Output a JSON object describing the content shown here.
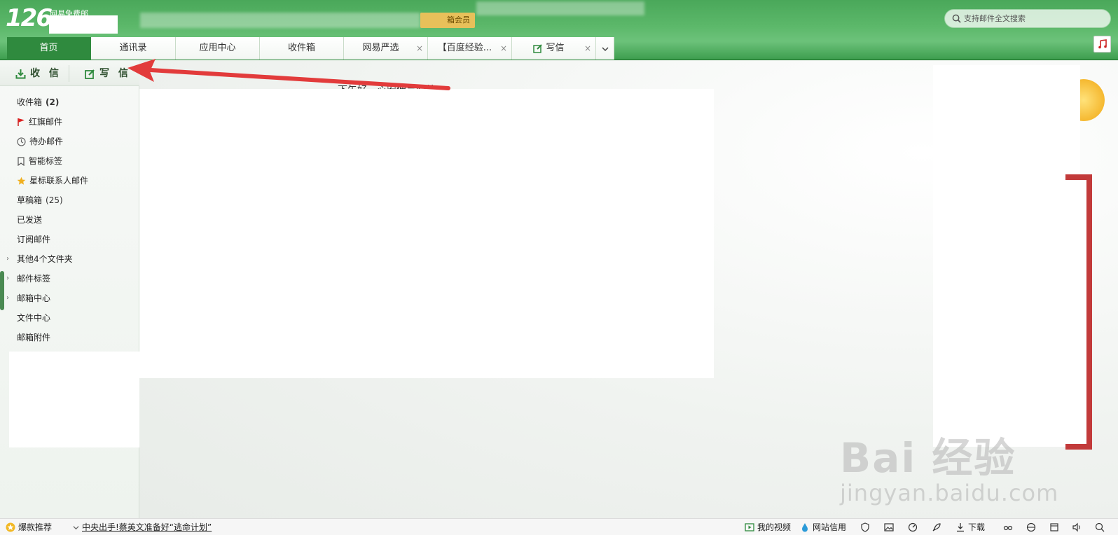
{
  "header": {
    "logo_number": "126",
    "logo_subtitle": "网易免费邮",
    "vip_label": "箱会员",
    "search_placeholder": "支持邮件全文搜索"
  },
  "tabs": [
    {
      "label": "首页",
      "active": true,
      "closable": false
    },
    {
      "label": "通讯录",
      "active": false,
      "closable": false
    },
    {
      "label": "应用中心",
      "active": false,
      "closable": false
    },
    {
      "label": "收件箱",
      "active": false,
      "closable": false
    },
    {
      "label": "网易严选",
      "active": false,
      "closable": true
    },
    {
      "label": "【百度经验...",
      "active": false,
      "closable": true
    },
    {
      "label": "写信",
      "active": false,
      "closable": true
    }
  ],
  "actions": {
    "receive_label": "收 信",
    "compose_label": "写 信"
  },
  "folders": [
    {
      "label": "收件箱",
      "count": "(2)",
      "bold_count": true,
      "icon": "",
      "arrow": false
    },
    {
      "label": "红旗邮件",
      "count": "",
      "icon": "flag-icon",
      "arrow": false
    },
    {
      "label": "待办邮件",
      "count": "",
      "icon": "clock-icon",
      "arrow": false
    },
    {
      "label": "智能标签",
      "count": "",
      "icon": "bookmark-icon",
      "arrow": false
    },
    {
      "label": "星标联系人邮件",
      "count": "",
      "icon": "star-icon",
      "arrow": false
    },
    {
      "label": "草稿箱",
      "count": "(25)",
      "bold_count": false,
      "icon": "",
      "arrow": false
    },
    {
      "label": "已发送",
      "count": "",
      "icon": "",
      "arrow": false
    },
    {
      "label": "订阅邮件",
      "count": "",
      "icon": "",
      "arrow": false
    },
    {
      "label": "其他4个文件夹",
      "count": "",
      "icon": "",
      "arrow": true
    },
    {
      "label": "邮件标签",
      "count": "",
      "icon": "",
      "arrow": true
    },
    {
      "label": "邮箱中心",
      "count": "",
      "icon": "",
      "arrow": true
    },
    {
      "label": "文件中心",
      "count": "",
      "icon": "",
      "arrow": false
    },
    {
      "label": "邮箱附件",
      "count": "",
      "icon": "",
      "arrow": false
    }
  ],
  "main": {
    "welcome_text": "下午好，心安便是归处"
  },
  "watermark": {
    "brand": "Bai 经验",
    "url": "jingyan.baidu.com"
  },
  "statusbar": {
    "hot_label": "爆款推荐",
    "news": "中央出手!蔡英文准备好“逃命计划”",
    "video_label": "我的视频",
    "credit_label": "网站信用",
    "download_label": "下载"
  },
  "colors": {
    "header_green": "#4aa85a",
    "active_tab": "#2f8a3e",
    "arrow_red": "#e23b3b",
    "promo_red": "#c23a3a"
  }
}
